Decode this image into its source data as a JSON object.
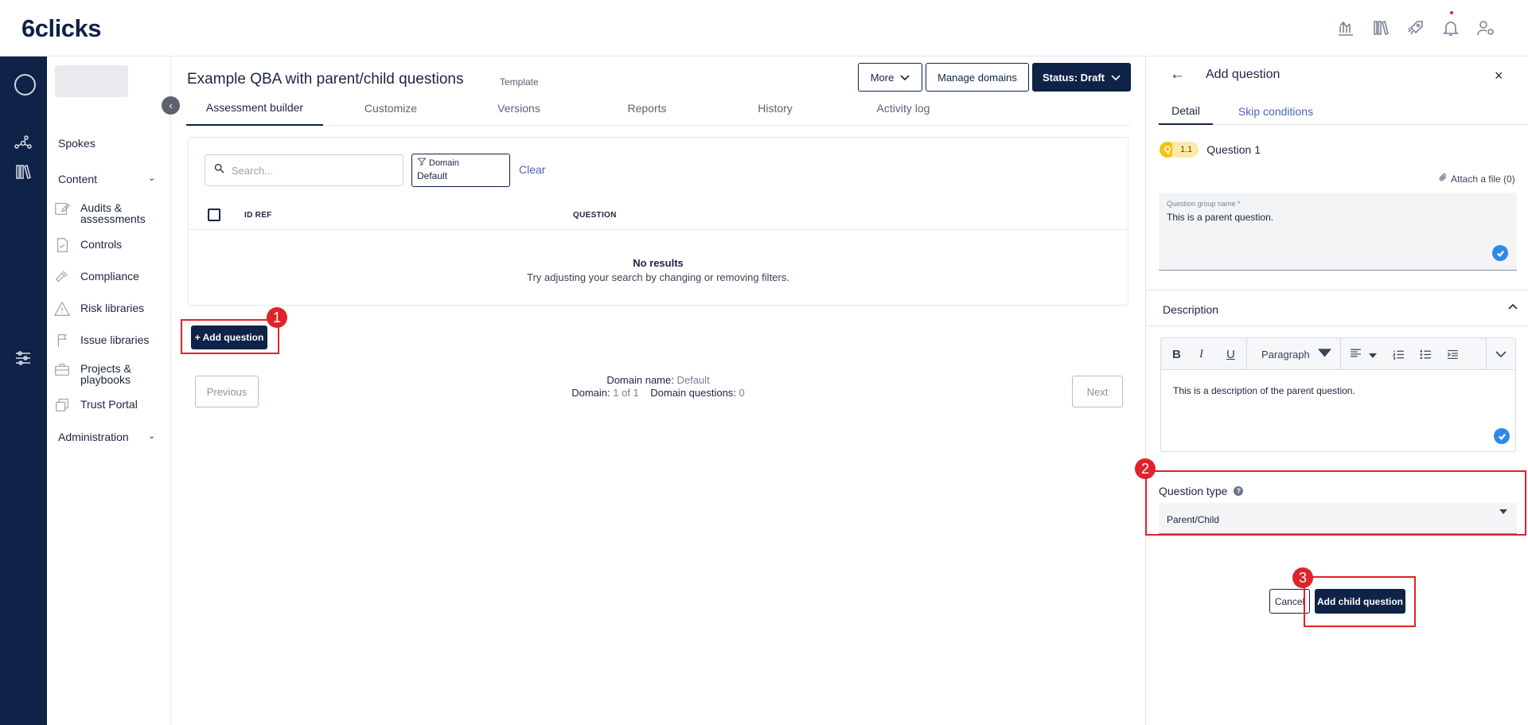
{
  "app": {
    "logo": "6clicks"
  },
  "topbar": {
    "icons": [
      "analytics-icon",
      "library-icon",
      "rocket-icon",
      "bell-icon",
      "user-settings-icon"
    ]
  },
  "sidebar": {
    "collapse_glyph": "‹",
    "top_items": [
      {
        "label": "Spokes",
        "icon": "hub-icon"
      },
      {
        "label": "Content",
        "icon": "books-icon",
        "chevron": "⌄"
      }
    ],
    "items": [
      {
        "label": "Audits & assessments",
        "icon": "edit-icon"
      },
      {
        "label": "Controls",
        "icon": "checklist-icon"
      },
      {
        "label": "Compliance",
        "icon": "gavel-icon"
      },
      {
        "label": "Risk libraries",
        "icon": "warning-icon"
      },
      {
        "label": "Issue libraries",
        "icon": "flag-icon"
      },
      {
        "label": "Projects & playbooks",
        "icon": "briefcase-icon"
      },
      {
        "label": "Trust Portal",
        "icon": "portal-icon"
      }
    ],
    "admin": {
      "label": "Administration",
      "icon": "sliders-icon",
      "chevron": "⌄"
    }
  },
  "header": {
    "title": "Example QBA with parent/child questions",
    "tag": "Template",
    "more_label": "More",
    "manage_domains_label": "Manage domains",
    "status_label": "Status: Draft"
  },
  "tabs": [
    "Assessment builder",
    "Customize",
    "Versions",
    "Reports",
    "History",
    "Activity log"
  ],
  "filters": {
    "search_placeholder": "Search...",
    "domain_label": "Domain",
    "domain_value": "Default",
    "clear_label": "Clear"
  },
  "table": {
    "columns": [
      "ID REF",
      "QUESTION"
    ],
    "empty_title": "No results",
    "empty_hint": "Try adjusting your search by changing or removing filters."
  },
  "add_question_label": "+ Add question",
  "pager": {
    "previous_label": "Previous",
    "next_label": "Next",
    "domain_name_label": "Domain name:",
    "domain_name_value": "Default",
    "domain_label": "Domain:",
    "domain_value": "1 of 1",
    "domain_questions_label": "Domain questions:",
    "domain_questions_value": "0"
  },
  "annotations": [
    "1",
    "2",
    "3"
  ],
  "panel": {
    "back_glyph": "←",
    "title": "Add question",
    "close_glyph": "×",
    "tabs": [
      "Detail",
      "Skip conditions"
    ],
    "badge_q": "Q",
    "badge_num": "1.1",
    "question_label": "Question 1",
    "attach_label": "Attach a file (0)",
    "group_name_label": "Question group name *",
    "group_name_value": "This is a parent question.",
    "description_label": "Description",
    "toolbar": {
      "bold": "B",
      "italic": "I",
      "underline": "U",
      "block_format": "Paragraph"
    },
    "description_text": "This is a description of the parent question.",
    "question_type_label": "Question type",
    "help_glyph": "?",
    "question_type_value": "Parent/Child",
    "cancel_label": "Cancel",
    "add_child_label": "Add child question"
  },
  "colors": {
    "navy": "#0f2247",
    "annotation_red": "#e0222a",
    "link_blue": "#4a63b8",
    "check_blue": "#2f88e8",
    "badge_yellow": "#f2c312"
  }
}
